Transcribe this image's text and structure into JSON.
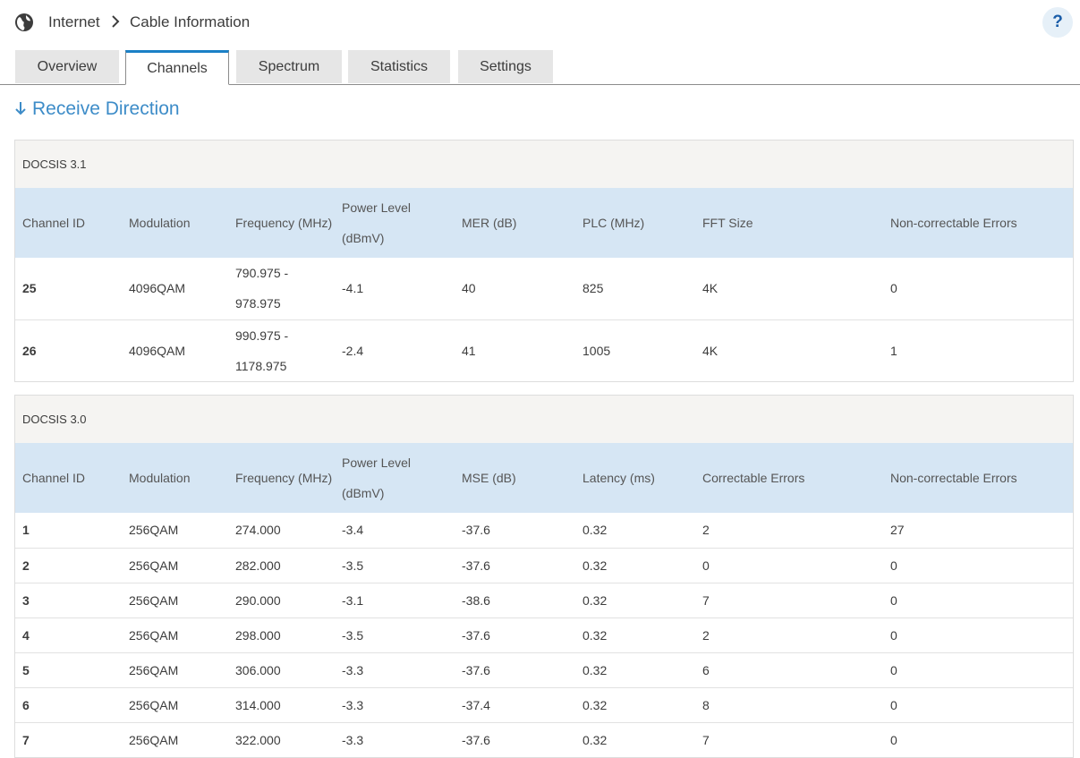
{
  "breadcrumb": {
    "items": [
      "Internet",
      "Cable Information"
    ]
  },
  "help": {
    "label": "?"
  },
  "tabs": [
    {
      "label": "Overview",
      "active": false
    },
    {
      "label": "Channels",
      "active": true
    },
    {
      "label": "Spectrum",
      "active": false
    },
    {
      "label": "Statistics",
      "active": false
    },
    {
      "label": "Settings",
      "active": false
    }
  ],
  "section": {
    "title": "Receive Direction"
  },
  "colors": {
    "accent": "#1a80c6",
    "title": "#3d8cc8",
    "header_row": "#d6e6f4",
    "panel_head": "#f5f4f2"
  },
  "docsis31": {
    "title": "DOCSIS 3.1",
    "columns": [
      "Channel ID",
      "Modulation",
      "Frequency (MHz)",
      "Power Level (dBmV)",
      "MER (dB)",
      "PLC (MHz)",
      "FFT Size",
      "Non-correctable Errors"
    ],
    "rows": [
      [
        "25",
        "4096QAM",
        "790.975 - 978.975",
        "-4.1",
        "40",
        "825",
        "4K",
        "0"
      ],
      [
        "26",
        "4096QAM",
        "990.975 - 1178.975",
        "-2.4",
        "41",
        "1005",
        "4K",
        "1"
      ]
    ]
  },
  "docsis30": {
    "title": "DOCSIS 3.0",
    "columns": [
      "Channel ID",
      "Modulation",
      "Frequency (MHz)",
      "Power Level (dBmV)",
      "MSE (dB)",
      "Latency (ms)",
      "Correctable Errors",
      "Non-correctable Errors"
    ],
    "rows": [
      [
        "1",
        "256QAM",
        "274.000",
        "-3.4",
        "-37.6",
        "0.32",
        "2",
        "27"
      ],
      [
        "2",
        "256QAM",
        "282.000",
        "-3.5",
        "-37.6",
        "0.32",
        "0",
        "0"
      ],
      [
        "3",
        "256QAM",
        "290.000",
        "-3.1",
        "-38.6",
        "0.32",
        "7",
        "0"
      ],
      [
        "4",
        "256QAM",
        "298.000",
        "-3.5",
        "-37.6",
        "0.32",
        "2",
        "0"
      ],
      [
        "5",
        "256QAM",
        "306.000",
        "-3.3",
        "-37.6",
        "0.32",
        "6",
        "0"
      ],
      [
        "6",
        "256QAM",
        "314.000",
        "-3.3",
        "-37.4",
        "0.32",
        "8",
        "0"
      ],
      [
        "7",
        "256QAM",
        "322.000",
        "-3.3",
        "-37.6",
        "0.32",
        "7",
        "0"
      ]
    ]
  }
}
